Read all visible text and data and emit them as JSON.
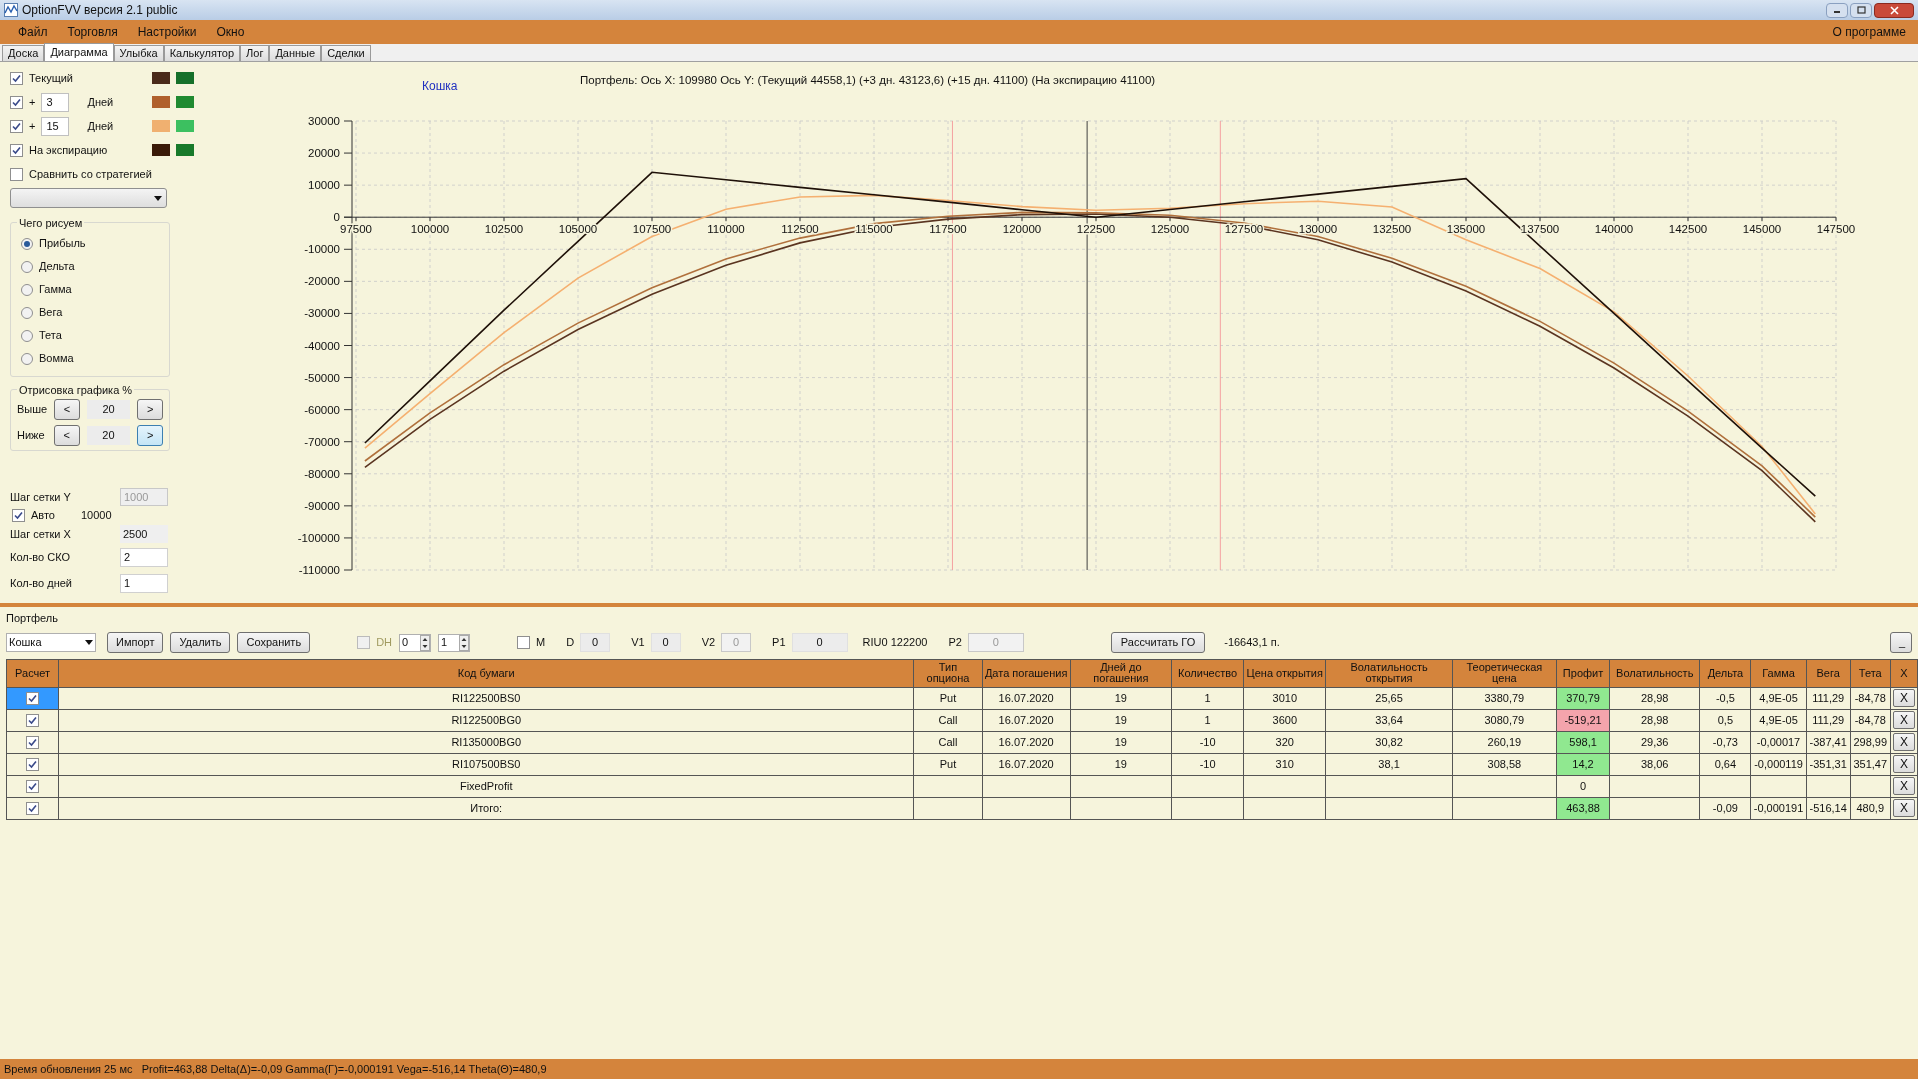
{
  "window": {
    "title": "OptionFVV версия 2.1 public"
  },
  "menu": {
    "items": [
      "Файл",
      "Торговля",
      "Настройки",
      "Окно"
    ],
    "right": "О программе"
  },
  "tabs": [
    {
      "label": "Доска",
      "selected": false
    },
    {
      "label": "Диаграмма",
      "selected": true
    },
    {
      "label": "Улыбка",
      "selected": false
    },
    {
      "label": "Калькулятор",
      "selected": false
    },
    {
      "label": "Лог",
      "selected": false
    },
    {
      "label": "Данные",
      "selected": false
    },
    {
      "label": "Сделки",
      "selected": false
    }
  ],
  "curves": [
    {
      "kind": "plain",
      "label": "Текущий",
      "checked": true,
      "swatches": [
        {
          "color": "#4a2a1a"
        },
        {
          "color": "#16702a"
        }
      ]
    },
    {
      "kind": "days",
      "prefix": "+",
      "days": "3",
      "unit": "Дней",
      "checked": true,
      "swatches": [
        {
          "color": "#b0602c"
        },
        {
          "color": "#1f8a30"
        }
      ]
    },
    {
      "kind": "days",
      "prefix": "+",
      "days": "15",
      "unit": "Дней",
      "checked": true,
      "swatches": [
        {
          "color": "#f0b070"
        },
        {
          "color": "#3cc060"
        }
      ]
    },
    {
      "kind": "plain",
      "label": "На экспирацию",
      "checked": true,
      "swatches": [
        {
          "color": "#3a1a08"
        },
        {
          "color": "#187a2a"
        }
      ]
    }
  ],
  "compare": {
    "label": "Сравнить со стратегией",
    "checked": false
  },
  "draw_what": {
    "title": "Чего рисуем",
    "options": [
      {
        "label": "Прибыль",
        "selected": true
      },
      {
        "label": "Дельта",
        "selected": false
      },
      {
        "label": "Гамма",
        "selected": false
      },
      {
        "label": "Вега",
        "selected": false
      },
      {
        "label": "Тета",
        "selected": false
      },
      {
        "label": "Вомма",
        "selected": false
      }
    ]
  },
  "range": {
    "title": "Отрисовка графика %",
    "rows": [
      {
        "label": "Выше",
        "dec": "<",
        "value": "20",
        "inc": ">",
        "focused": false
      },
      {
        "label": "Ниже",
        "dec": "<",
        "value": "20",
        "inc": ">",
        "focused": true
      }
    ]
  },
  "grid": {
    "y_step_label": "Шаг сетки Y",
    "y_step": "1000",
    "auto_label": "Авто",
    "auto": true,
    "auto_value": "10000",
    "x_step_label": "Шаг сетки X",
    "x_step": "2500",
    "sko_label": "Кол-во СКО",
    "sko": "2",
    "days_label": "Кол-во дней",
    "days": "1"
  },
  "chart": {
    "legend_name": "Кошка",
    "header": "Портфель: Ось X: 109980 Ось Y:  (Текущий 44558,1)  (+3 дн. 43123,6)  (+15 дн. 41100)  (На экспирацию 41100)",
    "chart_data": {
      "type": "line",
      "grid": true,
      "xlim": [
        97500,
        147500
      ],
      "ylim": [
        -110000,
        30000
      ],
      "xticks": [
        97500,
        100000,
        102500,
        105000,
        107500,
        110000,
        112500,
        115000,
        117500,
        120000,
        122500,
        125000,
        127500,
        130000,
        132500,
        135000,
        137500,
        140000,
        142500,
        145000,
        147500
      ],
      "yticks": [
        30000,
        20000,
        10000,
        0,
        -10000,
        -20000,
        -30000,
        -40000,
        -50000,
        -60000,
        -70000,
        -80000,
        -90000,
        -100000,
        -110000
      ],
      "x": [
        97800,
        100000,
        102500,
        105000,
        107500,
        110000,
        112500,
        115000,
        117500,
        120000,
        122500,
        125000,
        127500,
        130000,
        132500,
        135000,
        137500,
        140000,
        142500,
        145000,
        146800
      ],
      "series": [
        {
          "color": "#5a3420",
          "values": [
            -78000,
            -63000,
            -48000,
            -35000,
            -24000,
            -15000,
            -8000,
            -3200,
            -600,
            800,
            1000,
            0,
            -2500,
            -7000,
            -14000,
            -23000,
            -34000,
            -47000,
            -62000,
            -79000,
            -95000
          ]
        },
        {
          "color": "#b0703c",
          "values": [
            -76000,
            -61000,
            -46000,
            -33000,
            -22000,
            -13000,
            -6500,
            -2000,
            300,
            1500,
            1400,
            600,
            -1800,
            -6000,
            -12800,
            -21500,
            -32500,
            -45500,
            -60500,
            -77500,
            -93500
          ]
        },
        {
          "color": "#f5b070",
          "values": [
            -72000,
            -55000,
            -36000,
            -19000,
            -6000,
            2500,
            6300,
            6800,
            5200,
            3300,
            2200,
            2800,
            4200,
            5000,
            3200,
            -7000,
            -16000,
            -29500,
            -49500,
            -71500,
            -92500
          ]
        },
        {
          "color": "#1e1008",
          "values": [
            -70400,
            -51000,
            -29000,
            -7500,
            14000,
            11700,
            9300,
            7000,
            4700,
            2300,
            0,
            2400,
            4800,
            7200,
            9600,
            12000,
            -9000,
            -30000,
            -51000,
            -72000,
            -87000
          ]
        }
      ],
      "ref_lines": [
        {
          "axis": "x",
          "value": 117650,
          "color": "#f4a0a0"
        },
        {
          "axis": "x",
          "value": 122200,
          "color": "#404040"
        },
        {
          "axis": "x",
          "value": 126700,
          "color": "#f4a0a0"
        }
      ]
    }
  },
  "portfolio": {
    "title": "Портфель",
    "toolbar": [
      {
        "kind": "select",
        "value": "Кошка"
      },
      {
        "kind": "button",
        "label": "Импорт"
      },
      {
        "kind": "button",
        "label": "Удалить"
      },
      {
        "kind": "button",
        "label": "Сохранить"
      },
      {
        "kind": "checkbox",
        "label": "DH",
        "checked": false,
        "disabled": true
      },
      {
        "kind": "spinner",
        "value": "0"
      },
      {
        "kind": "spinner",
        "value": "1"
      },
      {
        "kind": "checkbox",
        "label": "M",
        "checked": false,
        "disabled": false
      },
      {
        "kind": "field",
        "label": "D",
        "value": "0",
        "disabled": false
      },
      {
        "kind": "field",
        "label": "V1",
        "value": "0",
        "disabled": false
      },
      {
        "kind": "field",
        "label": "V2",
        "value": "0",
        "disabled": true
      },
      {
        "kind": "field",
        "label": "P1",
        "value": "0",
        "disabled": false
      },
      {
        "kind": "text",
        "value": "RIU0 122200"
      },
      {
        "kind": "field",
        "label": "P2",
        "value": "0",
        "disabled": true
      },
      {
        "kind": "button",
        "label": "Рассчитать ГО"
      },
      {
        "kind": "text",
        "value": "-16643,1 п."
      }
    ],
    "collapse": "_"
  },
  "table": {
    "columns": [
      "Расчет",
      "Код бумаги",
      "Тип опциона",
      "Дата погашения",
      "Дней до погашения",
      "Количество",
      "Цена открытия",
      "Волатильность открытия",
      "Теоретическая цена",
      "Профит",
      "Волатильность",
      "Дельта",
      "Гамма",
      "Вега",
      "Тета",
      "X"
    ],
    "rows": [
      {
        "checked": true,
        "selected": true,
        "cells": [
          null,
          "RI122500BS0",
          "Put",
          "16.07.2020",
          "19",
          "1",
          "3010",
          "25,65",
          "3380,79",
          "370,79",
          "28,98",
          "-0,5",
          "4,9E-05",
          "111,29",
          "-84,78",
          "X"
        ],
        "profit_cell": {
          "color": "#90e890"
        }
      },
      {
        "checked": true,
        "selected": false,
        "cells": [
          null,
          "RI122500BG0",
          "Call",
          "16.07.2020",
          "19",
          "1",
          "3600",
          "33,64",
          "3080,79",
          "-519,21",
          "28,98",
          "0,5",
          "4,9E-05",
          "111,29",
          "-84,78",
          "X"
        ],
        "profit_cell": {
          "color": "#f4a4ac"
        }
      },
      {
        "checked": true,
        "selected": false,
        "cells": [
          null,
          "RI135000BG0",
          "Call",
          "16.07.2020",
          "19",
          "-10",
          "320",
          "30,82",
          "260,19",
          "598,1",
          "29,36",
          "-0,73",
          "-0,00017",
          "-387,41",
          "298,99",
          "X"
        ],
        "profit_cell": {
          "color": "#90e890"
        }
      },
      {
        "checked": true,
        "selected": false,
        "cells": [
          null,
          "RI107500BS0",
          "Put",
          "16.07.2020",
          "19",
          "-10",
          "310",
          "38,1",
          "308,58",
          "14,2",
          "38,06",
          "0,64",
          "-0,000119",
          "-351,31",
          "351,47",
          "X"
        ],
        "profit_cell": {
          "color": "#90e890"
        }
      },
      {
        "checked": true,
        "selected": false,
        "cells": [
          null,
          "FixedProfit",
          null,
          null,
          null,
          null,
          null,
          null,
          null,
          "0",
          null,
          null,
          null,
          null,
          null,
          "X"
        ]
      },
      {
        "checked": true,
        "selected": false,
        "cells": [
          null,
          "Итого:",
          null,
          null,
          null,
          null,
          null,
          null,
          null,
          "463,88",
          null,
          "-0,09",
          "-0,000191",
          "-516,14",
          "480,9",
          "X"
        ],
        "profit_cell": {
          "color": "#90e890"
        }
      }
    ]
  },
  "status_bar": "Время обновления 25 мс   Profit=463,88 Delta(Δ)=-0,09 Gamma(Γ)=-0,000191 Vega=-516,14 Theta(Θ)=480,9"
}
